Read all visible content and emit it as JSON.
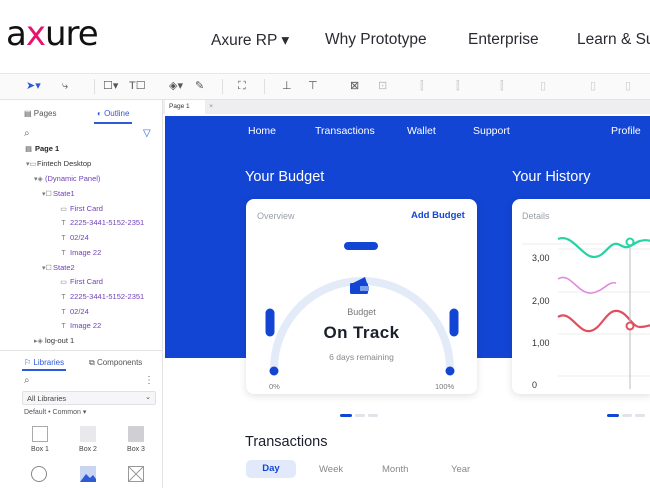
{
  "site": {
    "logo": {
      "prefix": "a",
      "accent": "x",
      "suffix": "ure"
    },
    "nav": [
      {
        "label": "Axure RP ▾"
      },
      {
        "label": "Why Prototype"
      },
      {
        "label": "Enterprise"
      },
      {
        "label": "Learn & Su"
      }
    ]
  },
  "toolbar": {
    "icons": [
      "pointer-icon",
      "connector-icon",
      "rectangle-icon",
      "text-icon",
      "dynamic-panel-icon",
      "layers-icon",
      "pen-icon",
      "fit-icon",
      "align-icon",
      "distribute-icon",
      "crop-icon"
    ]
  },
  "left_panel": {
    "tabs": {
      "pages": "Pages",
      "outline": "Outline"
    },
    "tree": [
      {
        "label": "Page 1",
        "icon": "page-icon"
      },
      {
        "label": "Fintech Desktop",
        "icon": "folder-icon"
      },
      {
        "label": "(Dynamic Panel)",
        "icon": "layers-icon"
      },
      {
        "label": "State1",
        "icon": "state-icon"
      },
      {
        "label": "First Card",
        "icon": "card-icon"
      },
      {
        "label": "2225-3441-5152-2351",
        "icon": "text-icon"
      },
      {
        "label": "02/24",
        "icon": "text-icon"
      },
      {
        "label": "Image 22",
        "icon": "text-icon"
      },
      {
        "label": "State2",
        "icon": "state-icon"
      },
      {
        "label": "First Card",
        "icon": "card-icon"
      },
      {
        "label": "2225-3441-5152-2351",
        "icon": "text-icon"
      },
      {
        "label": "02/24",
        "icon": "text-icon"
      },
      {
        "label": "Image 22",
        "icon": "text-icon"
      },
      {
        "label": "log-out 1",
        "icon": "layers-icon"
      }
    ],
    "libraries": {
      "tab_libraries": "Libraries",
      "tab_components": "Components",
      "select_value": "All Libraries",
      "breadcrumb": "Default • Common ▾",
      "widgets": [
        {
          "label": "Box 1"
        },
        {
          "label": "Box 2"
        },
        {
          "label": "Box 3"
        }
      ]
    }
  },
  "page_tabs": {
    "active": "Page 1"
  },
  "canvas": {
    "nav": [
      {
        "label": "Home"
      },
      {
        "label": "Transactions"
      },
      {
        "label": "Wallet"
      },
      {
        "label": "Support"
      },
      {
        "label": "Profile"
      }
    ],
    "budget_heading": "Your Budget",
    "history_heading": "Your History",
    "budget_card": {
      "label": "Overview",
      "action": "Add Budget",
      "title": "Budget",
      "status": "On Track",
      "subtitle": "6 days remaining",
      "min_label": "0%",
      "max_label": "100%"
    },
    "history_card": {
      "label": "Details",
      "y_ticks": [
        "3,00",
        "2,00",
        "1,00",
        "0"
      ]
    },
    "transactions": {
      "title": "Transactions",
      "tabs": [
        "Day",
        "Week",
        "Month",
        "Year"
      ]
    },
    "colors": {
      "brand_blue": "#1345d4",
      "teal": "#25d3a3",
      "red": "#e05060",
      "logo_accent": "#e8136f"
    }
  }
}
